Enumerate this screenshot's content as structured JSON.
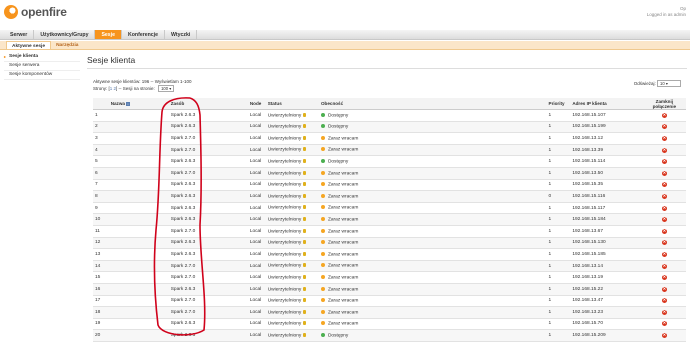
{
  "header": {
    "logo_text": "openfire",
    "user_line1": "Op",
    "user_line2": "Logged in as admin"
  },
  "nav": {
    "items": [
      "Serwer",
      "Użytkownicy/Grupy",
      "Sesje",
      "Konferencje",
      "Wtyczki"
    ],
    "active": "Sesje"
  },
  "subnav": {
    "items": [
      "Aktywne sesje",
      "Narzędzia"
    ]
  },
  "sidebar": {
    "items": [
      "Sesje klienta",
      "Sesje serwera",
      "Sesje komponentów"
    ]
  },
  "main": {
    "title": "Sesje klienta",
    "info_line": "Aktywne sesje klientów: 196 -- Wyświetlam 1-100",
    "pages_label": "Strony: [",
    "pages_links": "1 2",
    "pages_end": "] -- Sesji na stronie:",
    "per_page": "100",
    "refresh_label": "Odświeżaj:",
    "refresh_value": "10"
  },
  "table": {
    "headers": [
      "",
      "Nazwa",
      "Zasób",
      "Node",
      "Status",
      "Obecność",
      "Priority",
      "Adres IP klienta",
      "Zamknij połączenie"
    ],
    "rows": [
      {
        "num": "1",
        "resource": "Spark 2.6.3",
        "node": "Local",
        "status": "Uwierzytelniony",
        "presence": "Dostępny",
        "pcolor": "green",
        "priority": "1",
        "ip": "192.168.15.107"
      },
      {
        "num": "2",
        "resource": "Spark 2.6.3",
        "node": "Local",
        "status": "Uwierzytelniony",
        "presence": "Dostępny",
        "pcolor": "green",
        "priority": "1",
        "ip": "192.168.15.199"
      },
      {
        "num": "3",
        "resource": "Spark 2.7.0",
        "node": "Local",
        "status": "Uwierzytelniony",
        "presence": "Zaraz wracam",
        "pcolor": "orange",
        "priority": "1",
        "ip": "192.168.13.12"
      },
      {
        "num": "4",
        "resource": "Spark 2.7.0",
        "node": "Local",
        "status": "Uwierzytelniony",
        "presence": "Zaraz wracam",
        "pcolor": "orange",
        "priority": "1",
        "ip": "192.168.13.39"
      },
      {
        "num": "5",
        "resource": "Spark 2.6.3",
        "node": "Local",
        "status": "Uwierzytelniony",
        "presence": "Dostępny",
        "pcolor": "green",
        "priority": "1",
        "ip": "192.168.15.114"
      },
      {
        "num": "6",
        "resource": "Spark 2.7.0",
        "node": "Local",
        "status": "Uwierzytelniony",
        "presence": "Zaraz wracam",
        "pcolor": "orange",
        "priority": "1",
        "ip": "192.168.13.50"
      },
      {
        "num": "7",
        "resource": "Spark 2.6.3",
        "node": "Local",
        "status": "Uwierzytelniony",
        "presence": "Zaraz wracam",
        "pcolor": "orange",
        "priority": "1",
        "ip": "192.168.15.35"
      },
      {
        "num": "8",
        "resource": "Spark 2.6.3",
        "node": "Local",
        "status": "Uwierzytelniony",
        "presence": "Zaraz wracam",
        "pcolor": "orange",
        "priority": "0",
        "ip": "192.168.15.116"
      },
      {
        "num": "9",
        "resource": "Spark 2.6.3",
        "node": "Local",
        "status": "Uwierzytelniony",
        "presence": "Zaraz wracam",
        "pcolor": "orange",
        "priority": "1",
        "ip": "192.168.15.117"
      },
      {
        "num": "10",
        "resource": "Spark 2.6.3",
        "node": "Local",
        "status": "Uwierzytelniony",
        "presence": "Zaraz wracam",
        "pcolor": "orange",
        "priority": "1",
        "ip": "192.168.15.184"
      },
      {
        "num": "11",
        "resource": "Spark 2.7.0",
        "node": "Local",
        "status": "Uwierzytelniony",
        "presence": "Zaraz wracam",
        "pcolor": "orange",
        "priority": "1",
        "ip": "192.168.13.67"
      },
      {
        "num": "12",
        "resource": "Spark 2.6.3",
        "node": "Local",
        "status": "Uwierzytelniony",
        "presence": "Zaraz wracam",
        "pcolor": "orange",
        "priority": "1",
        "ip": "192.168.15.130"
      },
      {
        "num": "13",
        "resource": "Spark 2.6.3",
        "node": "Local",
        "status": "Uwierzytelniony",
        "presence": "Zaraz wracam",
        "pcolor": "orange",
        "priority": "1",
        "ip": "192.168.15.185"
      },
      {
        "num": "14",
        "resource": "Spark 2.7.0",
        "node": "Local",
        "status": "Uwierzytelniony",
        "presence": "Zaraz wracam",
        "pcolor": "orange",
        "priority": "1",
        "ip": "192.168.13.14"
      },
      {
        "num": "15",
        "resource": "Spark 2.7.0",
        "node": "Local",
        "status": "Uwierzytelniony",
        "presence": "Zaraz wracam",
        "pcolor": "orange",
        "priority": "1",
        "ip": "192.168.13.19"
      },
      {
        "num": "16",
        "resource": "Spark 2.6.3",
        "node": "Local",
        "status": "Uwierzytelniony",
        "presence": "Zaraz wracam",
        "pcolor": "orange",
        "priority": "1",
        "ip": "192.168.15.22"
      },
      {
        "num": "17",
        "resource": "Spark 2.7.0",
        "node": "Local",
        "status": "Uwierzytelniony",
        "presence": "Zaraz wracam",
        "pcolor": "orange",
        "priority": "1",
        "ip": "192.168.13.47"
      },
      {
        "num": "18",
        "resource": "Spark 2.7.0",
        "node": "Local",
        "status": "Uwierzytelniony",
        "presence": "Zaraz wracam",
        "pcolor": "orange",
        "priority": "1",
        "ip": "192.168.13.23"
      },
      {
        "num": "19",
        "resource": "Spark 2.6.3",
        "node": "Local",
        "status": "Uwierzytelniony",
        "presence": "Zaraz wracam",
        "pcolor": "orange",
        "priority": "1",
        "ip": "192.168.15.70"
      },
      {
        "num": "20",
        "resource": "Spark 2.6.3",
        "node": "Local",
        "status": "Uwierzytelniony",
        "presence": "Dostępny",
        "pcolor": "green",
        "priority": "1",
        "ip": "192.168.15.209"
      }
    ]
  },
  "colors": {
    "accent": "#f7941d",
    "annotation": "#d0021b",
    "close": "#d9341c"
  }
}
